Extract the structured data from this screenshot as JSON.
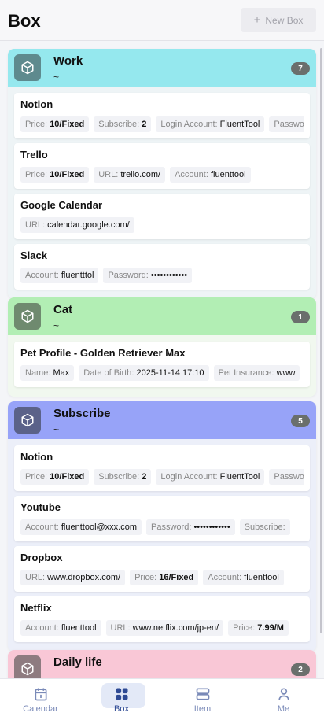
{
  "header": {
    "title": "Box",
    "new_box_label": "New Box"
  },
  "boxes": [
    {
      "name": "Work",
      "subtitle": "~",
      "count": "7",
      "items": [
        {
          "title": "Notion",
          "fields": [
            {
              "label": "Price:",
              "value": "10/Fixed",
              "bold": true
            },
            {
              "label": "Subscribe:",
              "value": "2",
              "bold": true
            },
            {
              "label": "Login Account:",
              "value": "FluentTool"
            },
            {
              "label": "Password:",
              "value": "••••••••••••"
            }
          ]
        },
        {
          "title": "Trello",
          "fields": [
            {
              "label": "Price:",
              "value": "10/Fixed",
              "bold": true
            },
            {
              "label": "URL:",
              "value": "trello.com/"
            },
            {
              "label": "Account:",
              "value": "fluenttool"
            }
          ]
        },
        {
          "title": "Google Calendar",
          "fields": [
            {
              "label": "URL:",
              "value": "calendar.google.com/"
            }
          ]
        },
        {
          "title": "Slack",
          "fields": [
            {
              "label": "Account:",
              "value": "fluentttol"
            },
            {
              "label": "Password:",
              "value": "••••••••••••"
            }
          ]
        }
      ]
    },
    {
      "name": "Cat",
      "subtitle": "~",
      "count": "1",
      "items": [
        {
          "title": "Pet Profile - Golden Retriever Max",
          "fields": [
            {
              "label": "Name:",
              "value": "Max"
            },
            {
              "label": "Date of Birth:",
              "value": "2025-11-14 17:10"
            },
            {
              "label": "Pet Insurance:",
              "value": "www"
            }
          ]
        }
      ]
    },
    {
      "name": "Subscribe",
      "subtitle": "~",
      "count": "5",
      "items": [
        {
          "title": "Notion",
          "fields": [
            {
              "label": "Price:",
              "value": "10/Fixed",
              "bold": true
            },
            {
              "label": "Subscribe:",
              "value": "2",
              "bold": true
            },
            {
              "label": "Login Account:",
              "value": "FluentTool"
            },
            {
              "label": "Password:",
              "value": "••••••••••••"
            }
          ]
        },
        {
          "title": "Youtube",
          "fields": [
            {
              "label": "Account:",
              "value": "fluenttool@xxx.com"
            },
            {
              "label": "Password:",
              "value": "••••••••••••"
            },
            {
              "label": "Subscribe:",
              "value": ""
            }
          ]
        },
        {
          "title": "Dropbox",
          "fields": [
            {
              "label": "URL:",
              "value": "www.dropbox.com/"
            },
            {
              "label": "Price:",
              "value": "16/Fixed",
              "bold": true
            },
            {
              "label": "Account:",
              "value": "fluenttool"
            }
          ]
        },
        {
          "title": "Netflix",
          "fields": [
            {
              "label": "Account:",
              "value": "fluenttool"
            },
            {
              "label": "URL:",
              "value": "www.netflix.com/jp-en/"
            },
            {
              "label": "Price:",
              "value": "7.99/M",
              "bold": true
            }
          ]
        }
      ]
    },
    {
      "name": "Daily life",
      "subtitle": "~",
      "count": "2",
      "items": []
    }
  ],
  "nav": [
    {
      "label": "Calendar",
      "icon": "calendar-icon",
      "active": false
    },
    {
      "label": "Box",
      "icon": "grid-icon",
      "active": true
    },
    {
      "label": "Item",
      "icon": "list-icon",
      "active": false
    },
    {
      "label": "Me",
      "icon": "person-icon",
      "active": false
    }
  ]
}
